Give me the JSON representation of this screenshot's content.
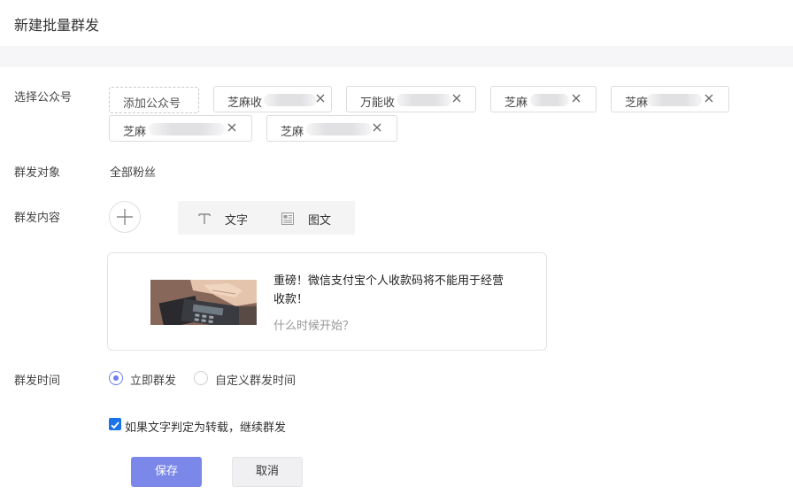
{
  "page": {
    "title": "新建批量群发"
  },
  "accounts": {
    "label": "选择公众号",
    "add_label": "添加公众号",
    "tags": [
      {
        "text": "芝麻收"
      },
      {
        "text": "万能收"
      },
      {
        "text": "芝麻"
      },
      {
        "text": "芝麻"
      },
      {
        "text": "芝麻"
      },
      {
        "text": "芝麻"
      }
    ]
  },
  "target": {
    "label": "群发对象",
    "value": "全部粉丝"
  },
  "content": {
    "label": "群发内容",
    "types": [
      {
        "label": "文字",
        "icon": "text-icon"
      },
      {
        "label": "图文",
        "icon": "article-icon"
      }
    ],
    "article": {
      "title": "重磅！微信支付宝个人收款码将不能用于经营收款！",
      "subtitle": "什么时候开始？"
    }
  },
  "time": {
    "label": "群发时间",
    "options": [
      {
        "label": "立即群发",
        "selected": true
      },
      {
        "label": "自定义群发时间",
        "selected": false
      }
    ]
  },
  "repost_option": {
    "label": "如果文字判定为转载，继续群发",
    "checked": true
  },
  "actions": {
    "save": "保存",
    "cancel": "取消"
  },
  "colors": {
    "primary": "#7b88ea",
    "checkbox": "#1a73e8"
  }
}
